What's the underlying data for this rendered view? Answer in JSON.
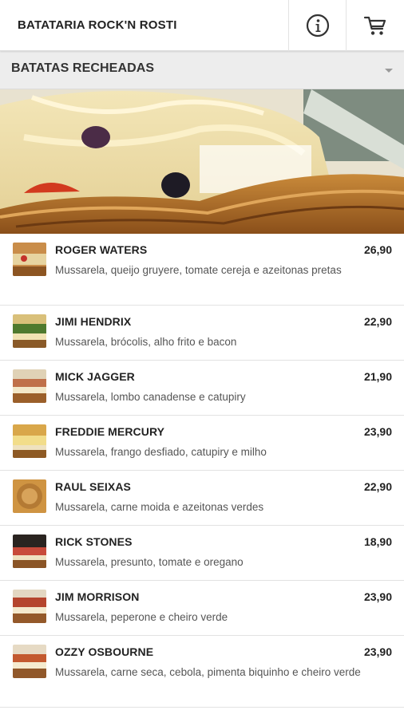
{
  "header": {
    "title": "BATATARIA ROCK'N ROSTI",
    "info_icon": "info-circle-icon",
    "cart_icon": "shopping-cart-icon"
  },
  "category": {
    "title": "BATATAS RECHEADAS",
    "dropdown_icon": "caret-down-icon"
  },
  "items": [
    {
      "name": "ROGER WATERS",
      "price": "26,90",
      "desc": "Mussarela, queijo gruyere, tomate cereja e azeitonas pretas"
    },
    {
      "name": "JIMI HENDRIX",
      "price": "22,90",
      "desc": "Mussarela, brócolis, alho frito e bacon"
    },
    {
      "name": "MICK JAGGER",
      "price": "21,90",
      "desc": "Mussarela, lombo canadense e catupiry"
    },
    {
      "name": "FREDDIE MERCURY",
      "price": "23,90",
      "desc": "Mussarela, frango desfiado, catupiry e milho"
    },
    {
      "name": "RAUL SEIXAS",
      "price": "22,90",
      "desc": "Mussarela, carne moida e azeitonas verdes"
    },
    {
      "name": "RICK STONES",
      "price": "18,90",
      "desc": "Mussarela, presunto, tomate e oregano"
    },
    {
      "name": "JIM MORRISON",
      "price": "23,90",
      "desc": "Mussarela, peperone e cheiro verde"
    },
    {
      "name": "OZZY OSBOURNE",
      "price": "23,90",
      "desc": "Mussarela, carne seca, cebola, pimenta biquinho e cheiro verde"
    }
  ],
  "colors": {
    "header_bg": "#ffffff",
    "category_bg": "#ededed",
    "text": "#222222",
    "muted_text": "#555555"
  }
}
